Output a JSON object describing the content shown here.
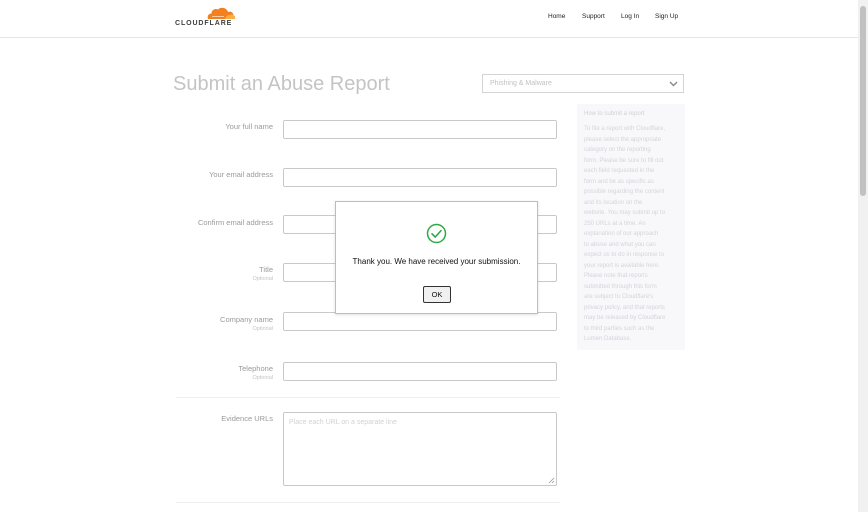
{
  "brand": {
    "name": "CLOUDFLARE",
    "color": "#f38020"
  },
  "nav": {
    "home": "Home",
    "support": "Support",
    "login": "Log In",
    "signup": "Sign Up"
  },
  "page": {
    "title": "Submit an Abuse Report"
  },
  "category_select": {
    "value": "Phishing & Malware"
  },
  "form": {
    "full_name_label": "Your full name",
    "email_label": "Your email address",
    "confirm_email_label": "Confirm email address",
    "title_label": "Title",
    "title_optional": "Optional",
    "company_label": "Company name",
    "company_optional": "Optional",
    "telephone_label": "Telephone",
    "telephone_optional": "Optional",
    "evidence_label": "Evidence URLs",
    "evidence_placeholder": "Place each URL on a separate line"
  },
  "help": {
    "title": "How to submit a report",
    "lines": [
      "To file a report with Cloudflare,",
      "please select the appropriate",
      "category on the reporting",
      "form. Please be sure to fill out",
      "each field requested in the",
      "form and be as specific as",
      "possible regarding the content",
      "and its location on the",
      "website. You may submit up to",
      "250 URLs at a time. An",
      "explanation of our approach",
      "to abuse and what you can",
      "expect us to do in response to",
      "your report is available here.",
      "Please note that reports",
      "submitted through this form",
      "are subject to Cloudflare's",
      "privacy policy, and that reports",
      "may be released by Cloudflare",
      "to third parties such as the",
      "Lumen Database."
    ]
  },
  "modal": {
    "message": "Thank you. We have received your submission.",
    "ok_label": "OK",
    "success_color": "#2ea844"
  }
}
